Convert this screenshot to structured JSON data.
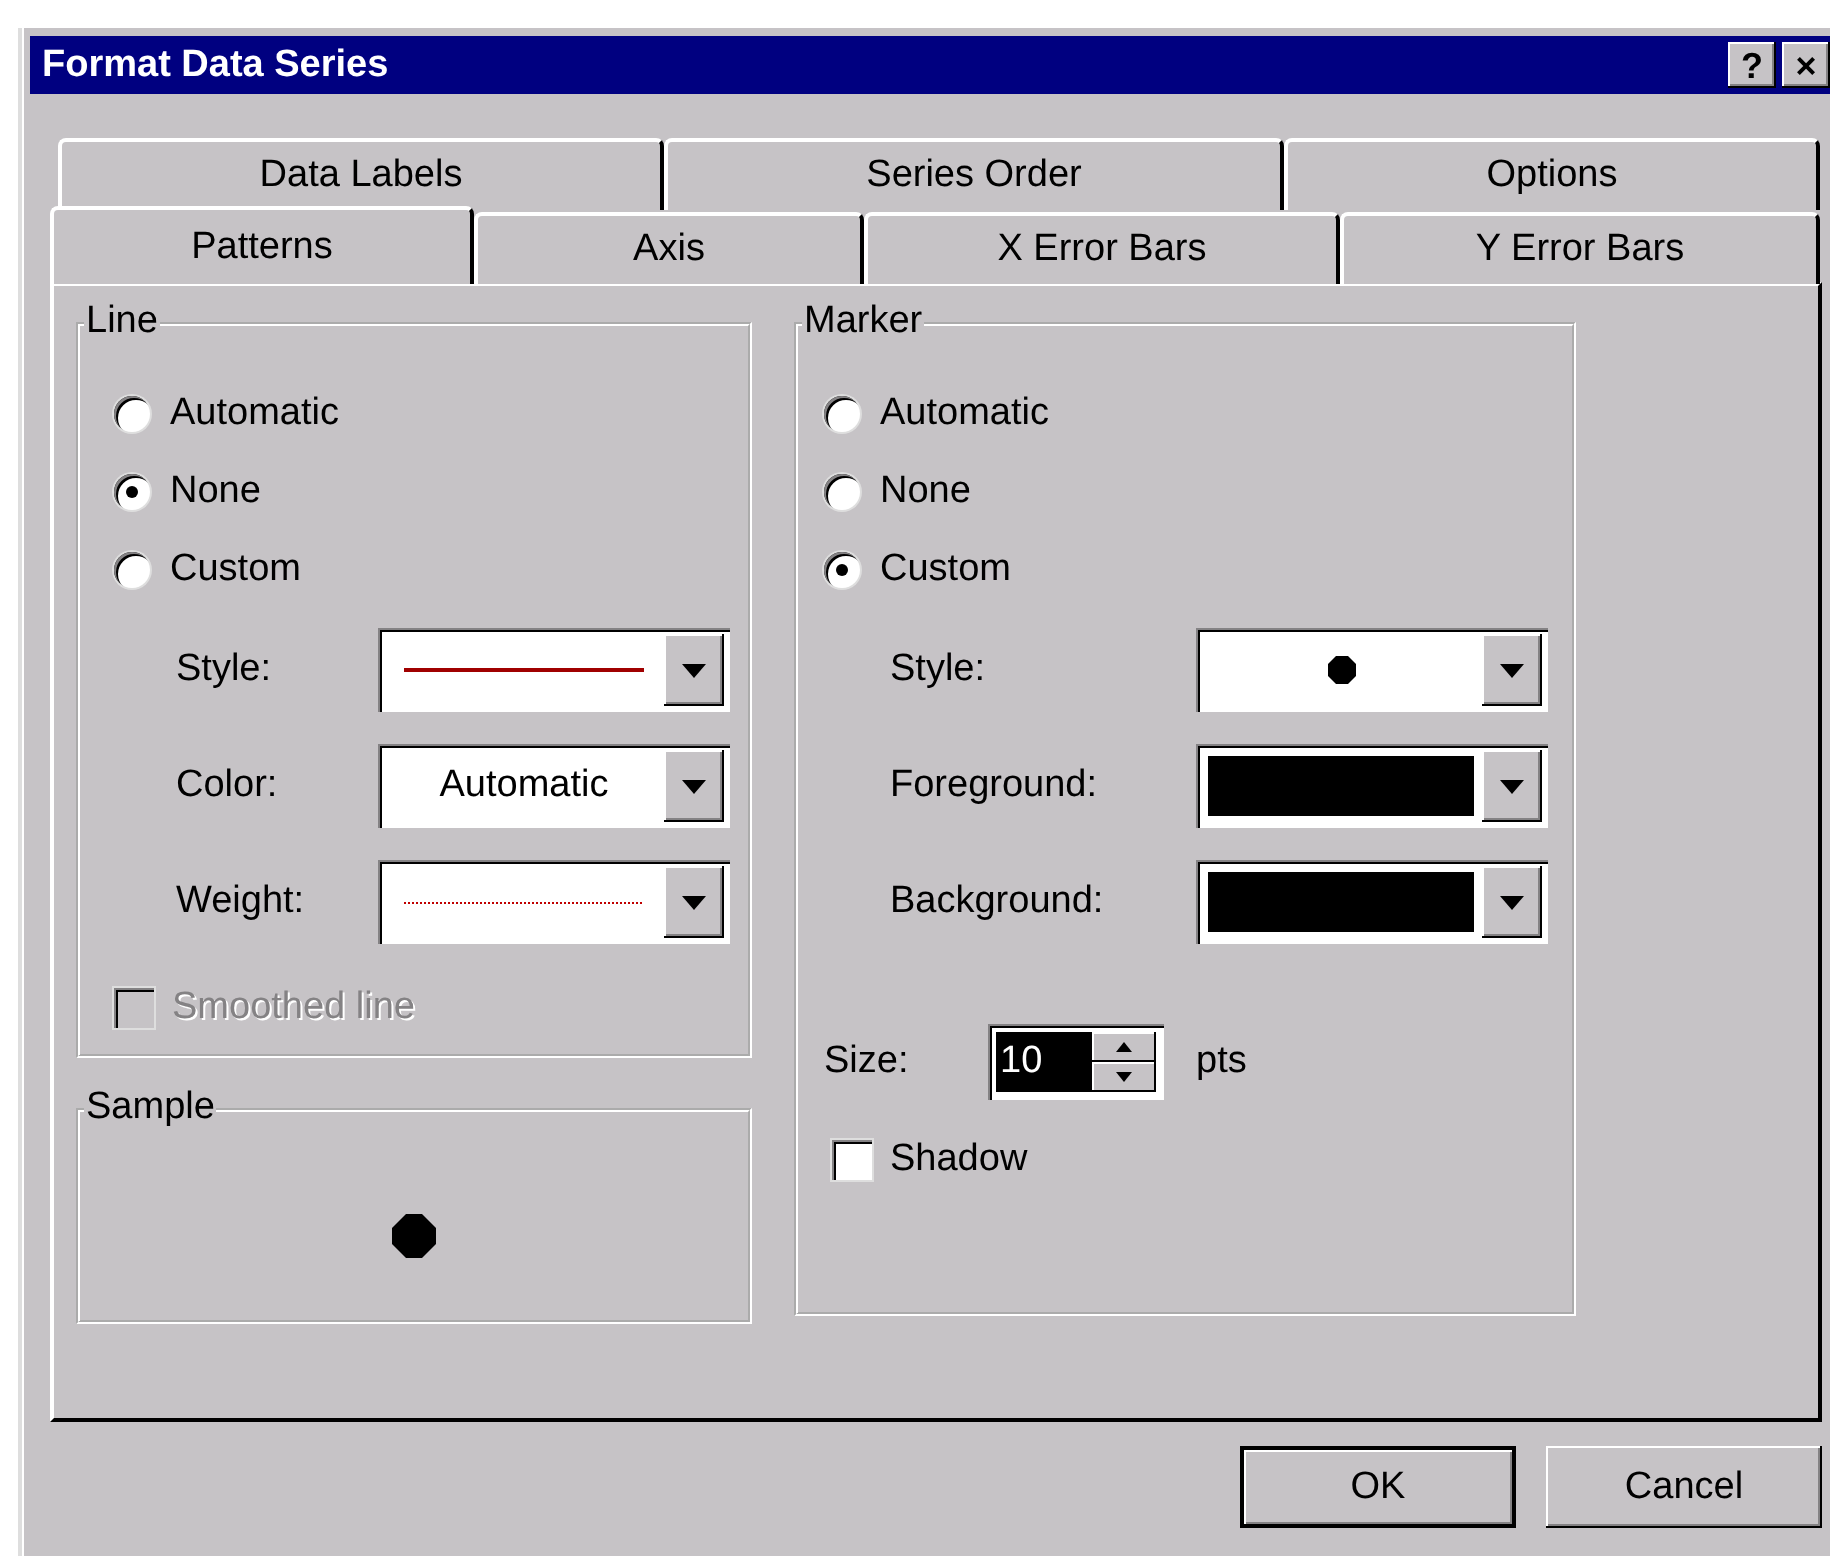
{
  "window": {
    "title": "Format Data Series",
    "help": "?",
    "close": "×"
  },
  "tab_rows": [
    [
      {
        "label": "Data Labels",
        "selected": false
      },
      {
        "label": "Series Order",
        "selected": false
      },
      {
        "label": "Options",
        "selected": false
      }
    ],
    [
      {
        "label": "Patterns",
        "selected": true
      },
      {
        "label": "Axis",
        "selected": false
      },
      {
        "label": "X Error Bars",
        "selected": false
      },
      {
        "label": "Y Error Bars",
        "selected": false
      }
    ]
  ],
  "line": {
    "title": "Line",
    "options": [
      {
        "label": "Automatic",
        "selected": false
      },
      {
        "label": "None",
        "selected": true
      },
      {
        "label": "Custom",
        "selected": false
      }
    ],
    "fields": [
      {
        "label": "Style:",
        "kind": "line",
        "color": "#a00000"
      },
      {
        "label": "Color:",
        "kind": "text",
        "value": "Automatic"
      },
      {
        "label": "Weight:",
        "kind": "weight",
        "color": "#c00000"
      }
    ],
    "checkbox": {
      "label": "Smoothed line",
      "checked": false,
      "disabled": true
    }
  },
  "sample": {
    "title": "Sample"
  },
  "marker": {
    "title": "Marker",
    "options": [
      {
        "label": "Automatic",
        "selected": false
      },
      {
        "label": "None",
        "selected": false
      },
      {
        "label": "Custom",
        "selected": true
      }
    ],
    "fields": [
      {
        "label": "Style:",
        "kind": "marker"
      },
      {
        "label": "Foreground:",
        "kind": "swatch",
        "color": "#000000"
      },
      {
        "label": "Background:",
        "kind": "swatch",
        "color": "#000000"
      }
    ],
    "size": {
      "label": "Size:",
      "value": "10",
      "unit": "pts"
    },
    "checkbox": {
      "label": "Shadow",
      "checked": false,
      "disabled": false
    }
  },
  "buttons": [
    {
      "label": "OK",
      "default": true
    },
    {
      "label": "Cancel",
      "default": false
    }
  ]
}
